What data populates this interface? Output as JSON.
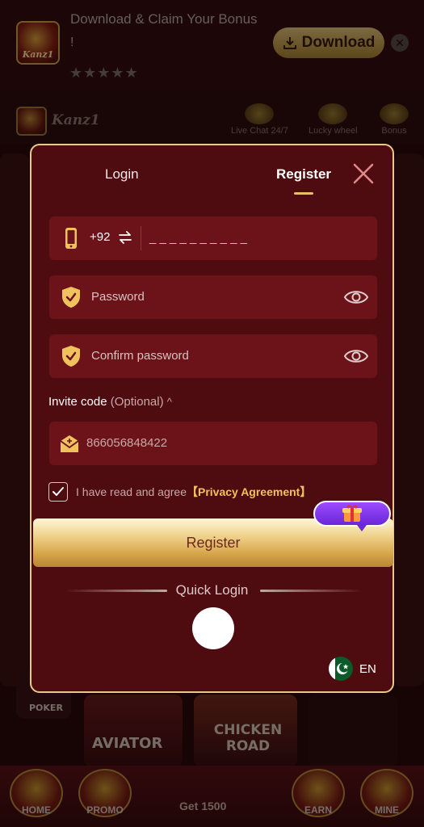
{
  "banner": {
    "title": "Download & Claim Your Bonus",
    "mark": "!",
    "stars": "★★★★★",
    "logo_text": "Kanz1",
    "download_label": "Download",
    "close_glyph": "✕"
  },
  "app": {
    "name": "Kanz1",
    "header_items": [
      "Live Chat 24/7",
      "Lucky wheel",
      "Bonus"
    ],
    "tiles": [
      "POKER",
      "AVIATOR",
      "CHICKEN ROAD"
    ],
    "nav": [
      "HOME",
      "PROMO",
      "Get 1500",
      "EARN",
      "MINE"
    ]
  },
  "modal": {
    "tabs": {
      "login": "Login",
      "register": "Register",
      "active": "register"
    },
    "phone": {
      "country_code": "+92",
      "placeholder": "_ _ _ _ _ _ _ _ _ _"
    },
    "password": {
      "placeholder": "Password"
    },
    "confirm_password": {
      "placeholder": "Confirm password"
    },
    "invite": {
      "label": "Invite code",
      "optional": "(Optional)",
      "caret": "^",
      "value": "866056848422"
    },
    "agreement": {
      "text": "I have read and agree",
      "link": "【Privacy Agreement】",
      "checked": true
    },
    "register_button": "Register",
    "quick_login": "Quick Login",
    "language": "EN"
  },
  "colors": {
    "accent": "#e5c06a",
    "modal_bg": "#4f0c10",
    "field_bg": "#6b1318"
  },
  "icons": [
    "download-icon",
    "close-icon",
    "phone-icon",
    "swap-icon",
    "shield-check-icon",
    "eye-icon",
    "envelope-icon",
    "checkmark-icon",
    "gift-icon",
    "pakistan-flag-icon"
  ]
}
